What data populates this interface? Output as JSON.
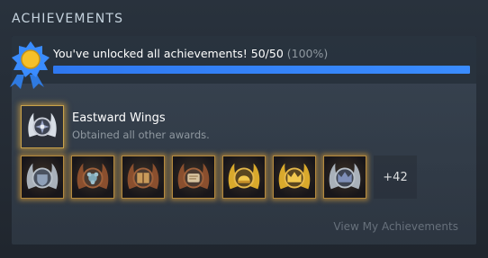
{
  "section": {
    "title": "ACHIEVEMENTS"
  },
  "summary": {
    "message": "You've unlocked all achievements! 50/50",
    "percent_text": "(100%)",
    "progress_fraction": 1.0
  },
  "featured": {
    "name": "Eastward Wings",
    "description": "Obtained all other awards.",
    "icon": "winged-emblem-icon"
  },
  "achievements": [
    {
      "icon": "silver-shield-badge-icon",
      "tone": "silver"
    },
    {
      "icon": "bronze-flower-badge-icon",
      "tone": "bronze"
    },
    {
      "icon": "bronze-book-badge-icon",
      "tone": "bronze"
    },
    {
      "icon": "bronze-scroll-badge-icon",
      "tone": "bronze"
    },
    {
      "icon": "gold-helmet-badge-icon",
      "tone": "gold"
    },
    {
      "icon": "gold-crown-badge-icon",
      "tone": "gold"
    },
    {
      "icon": "silver-crown-badge-icon",
      "tone": "silver"
    }
  ],
  "more_count": "+42",
  "view_link": "View My Achievements",
  "colors": {
    "progress": "#3a8cff",
    "gold_glow": "#ffbe3c",
    "bronze": "#a0613a",
    "silver": "#b8c0c8",
    "gold": "#d9a92c"
  }
}
